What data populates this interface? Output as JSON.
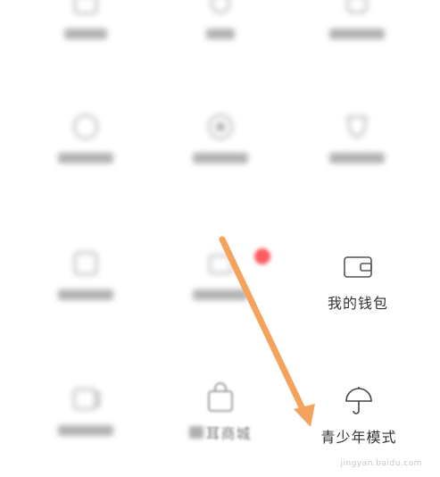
{
  "menu": {
    "wallet_label": "我的钱包",
    "mall_label": "耳商城",
    "teen_mode_label": "青少年模式"
  },
  "icons": {
    "wallet": "wallet-icon",
    "mall": "shopping-bag-icon",
    "teen_mode": "umbrella-icon"
  },
  "watermark": {
    "site": "jingyan.baidu.com"
  },
  "colors": {
    "arrow": "#f5a25d",
    "badge": "#ff5a5f"
  }
}
